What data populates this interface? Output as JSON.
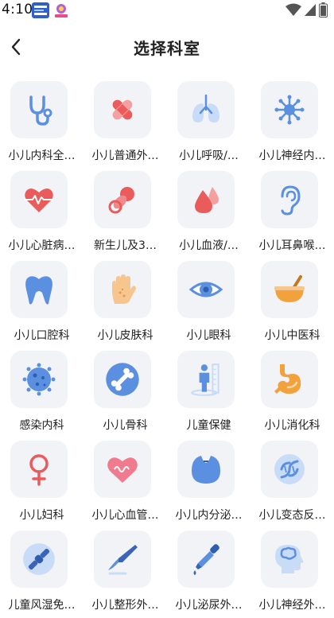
{
  "status": {
    "time": "4:10"
  },
  "header": {
    "title": "选择科室"
  },
  "departments": [
    {
      "label": "小儿内科全…",
      "icon": "stethoscope-icon"
    },
    {
      "label": "小儿普通外…",
      "icon": "bandage-icon"
    },
    {
      "label": "小儿呼吸/…",
      "icon": "lungs-icon"
    },
    {
      "label": "小儿神经内…",
      "icon": "neuron-icon"
    },
    {
      "label": "小儿心脏病…",
      "icon": "heart-pulse-icon"
    },
    {
      "label": "新生儿及3…",
      "icon": "pacifier-icon"
    },
    {
      "label": "小儿血液/…",
      "icon": "blood-drop-icon"
    },
    {
      "label": "小儿耳鼻喉…",
      "icon": "ear-icon"
    },
    {
      "label": "小儿口腔科",
      "icon": "tooth-icon"
    },
    {
      "label": "小儿皮肤科",
      "icon": "hand-skin-icon"
    },
    {
      "label": "小儿眼科",
      "icon": "eye-icon"
    },
    {
      "label": "小儿中医科",
      "icon": "mortar-pestle-icon"
    },
    {
      "label": "感染内科",
      "icon": "virus-icon"
    },
    {
      "label": "小儿骨科",
      "icon": "bone-icon"
    },
    {
      "label": "儿童保健",
      "icon": "child-height-icon"
    },
    {
      "label": "小儿消化科",
      "icon": "stomach-icon"
    },
    {
      "label": "小儿妇科",
      "icon": "female-symbol-icon"
    },
    {
      "label": "小儿心血管…",
      "icon": "heart-wave-icon"
    },
    {
      "label": "小儿内分泌…",
      "icon": "thyroid-icon"
    },
    {
      "label": "小儿变态反…",
      "icon": "dna-icon"
    },
    {
      "label": "儿童风湿免…",
      "icon": "joint-icon"
    },
    {
      "label": "小儿整形外…",
      "icon": "scalpel-icon"
    },
    {
      "label": "小儿泌尿外…",
      "icon": "dropper-icon"
    },
    {
      "label": "小儿神经外…",
      "icon": "brain-head-icon"
    }
  ],
  "colors": {
    "blue": "#5b8fe0",
    "light_blue": "#c9dcf7",
    "red": "#ea5b5b",
    "pink": "#f07a8e",
    "orange": "#f2a23c",
    "skin": "#f7c58e",
    "tile": "#f2f3f7"
  }
}
